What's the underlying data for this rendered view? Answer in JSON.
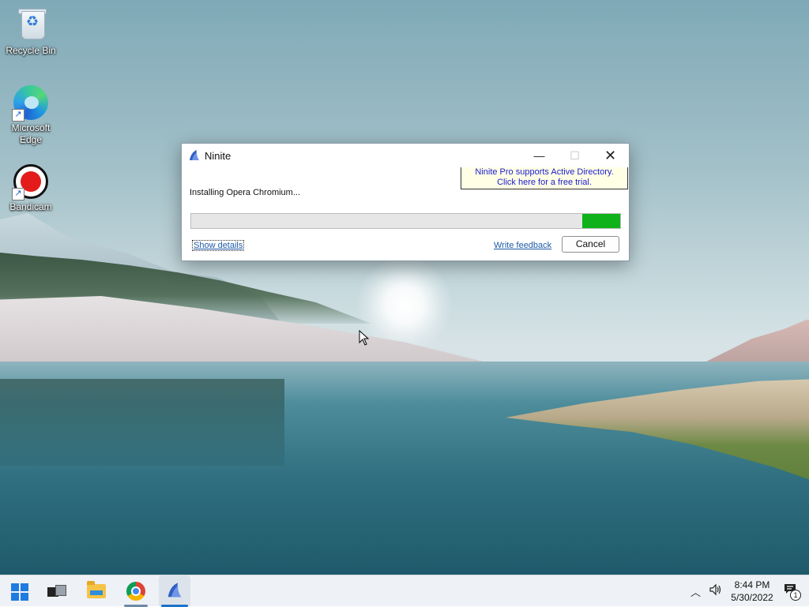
{
  "desktop": {
    "icons": [
      {
        "label": "Recycle Bin"
      },
      {
        "label": "Microsoft Edge"
      },
      {
        "label": "Bandicam"
      }
    ]
  },
  "dialog": {
    "title": "Ninite",
    "promo_line1": "Ninite Pro supports Active Directory.",
    "promo_line2": "Click here for a free trial.",
    "status": "Installing Opera Chromium...",
    "progress": 0.088,
    "progress_color": "#0fb21b",
    "show_details": "Show details",
    "write_feedback": "Write feedback",
    "cancel": "Cancel"
  },
  "taskbar": {
    "items": [
      "start",
      "task-view",
      "file-explorer",
      "chrome",
      "ninite"
    ],
    "time": "8:44 PM",
    "date": "5/30/2022",
    "notification_count": "1"
  },
  "colors": {
    "accent": "#1a73c9",
    "link": "#1e5aa8"
  }
}
